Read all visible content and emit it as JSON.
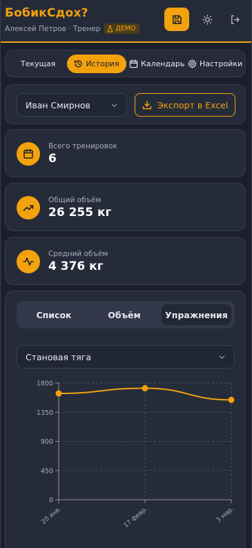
{
  "header": {
    "title": "БобикСдох?",
    "user": "Алексей Петров · Тренер",
    "demo_badge": "ДЕМО"
  },
  "nav": {
    "tabs": [
      {
        "label": "Текущая",
        "active": false
      },
      {
        "label": "История",
        "active": true
      },
      {
        "label": "Календарь",
        "active": false
      },
      {
        "label": "Настройки",
        "active": false
      }
    ]
  },
  "filter": {
    "athlete": "Иван Смирнов",
    "export_label": "Экспорт в Excel"
  },
  "stats": [
    {
      "label": "Всего тренировок",
      "value": "6",
      "icon": "calendar-icon"
    },
    {
      "label": "Общий объём",
      "value": "26 255 кг",
      "icon": "trending-up-icon"
    },
    {
      "label": "Средний объём",
      "value": "4 376 кг",
      "icon": "activity-icon"
    }
  ],
  "views": {
    "tabs": [
      {
        "label": "Список",
        "active": false
      },
      {
        "label": "Объём",
        "active": false
      },
      {
        "label": "Упражнения",
        "active": true
      }
    ]
  },
  "exercise_select": "Становая тяга",
  "colors": {
    "accent": "#f2a20d",
    "background": "#1b1f2b",
    "card": "#262b3a"
  },
  "chart_data": {
    "type": "line",
    "x": [
      "20 янв.",
      "17 февр.",
      "3 мар."
    ],
    "series": [
      {
        "values": [
          1640,
          1720,
          1540
        ]
      }
    ],
    "yticks": [
      0,
      450,
      900,
      1350,
      1800
    ],
    "ylim": [
      0,
      1800
    ],
    "grid": true
  }
}
